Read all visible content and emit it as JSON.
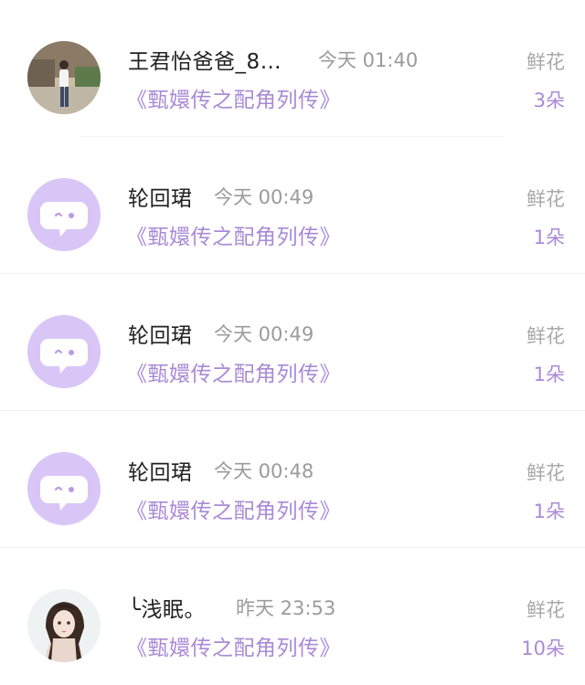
{
  "accent_color": "#a98ad6",
  "avatar_default_color": "#d9c6f6",
  "items": [
    {
      "name": "王君怡爸爸_8…",
      "time": "今天 01:40",
      "book": "《甄嬛传之配角列传》",
      "label": "鲜花",
      "count": "3朵",
      "avatar": "user-photo"
    },
    {
      "name": "轮回珺",
      "time": "今天 00:49",
      "book": "《甄嬛传之配角列传》",
      "label": "鲜花",
      "count": "1朵",
      "avatar": "default-chat-bubble"
    },
    {
      "name": "轮回珺",
      "time": "今天 00:49",
      "book": "《甄嬛传之配角列传》",
      "label": "鲜花",
      "count": "1朵",
      "avatar": "default-chat-bubble"
    },
    {
      "name": "轮回珺",
      "time": "今天 00:48",
      "book": "《甄嬛传之配角列传》",
      "label": "鲜花",
      "count": "1朵",
      "avatar": "default-chat-bubble"
    },
    {
      "name": "╰浅眠。",
      "time": "昨天 23:53",
      "book": "《甄嬛传之配角列传》",
      "label": "鲜花",
      "count": "10朵",
      "avatar": "anime-girl-avatar"
    }
  ]
}
